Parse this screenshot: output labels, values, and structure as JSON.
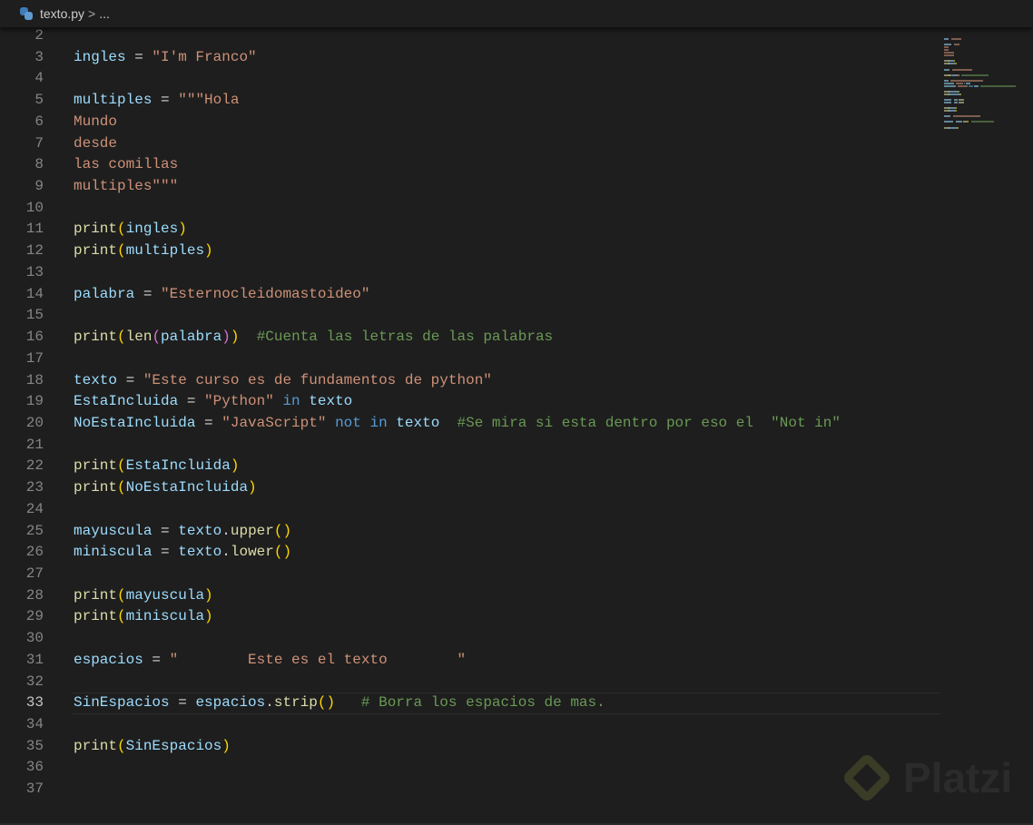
{
  "header": {
    "file_name": "texto.py",
    "separator": ">",
    "ellipsis": "..."
  },
  "watermark": "Platzi",
  "colors": {
    "background": "#1e1e1e",
    "variable": "#9cdcfe",
    "string": "#ce9178",
    "function": "#dcdcaa",
    "keyword": "#569cd6",
    "comment": "#6a9955"
  },
  "active_line": 33,
  "lines": [
    {
      "n": "2",
      "t": []
    },
    {
      "n": "3",
      "t": [
        [
          "var",
          "ingles"
        ],
        [
          "op",
          " = "
        ],
        [
          "str",
          "\"I'm Franco\""
        ]
      ]
    },
    {
      "n": "4",
      "t": []
    },
    {
      "n": "5",
      "t": [
        [
          "var",
          "multiples"
        ],
        [
          "op",
          " = "
        ],
        [
          "str",
          "\"\"\"Hola"
        ]
      ]
    },
    {
      "n": "6",
      "t": [
        [
          "str",
          "Mundo"
        ]
      ]
    },
    {
      "n": "7",
      "t": [
        [
          "str",
          "desde"
        ]
      ]
    },
    {
      "n": "8",
      "t": [
        [
          "str",
          "las comillas"
        ]
      ]
    },
    {
      "n": "9",
      "t": [
        [
          "str",
          "multiples\"\"\""
        ]
      ]
    },
    {
      "n": "10",
      "t": []
    },
    {
      "n": "11",
      "t": [
        [
          "fn",
          "print"
        ],
        [
          "p1",
          "("
        ],
        [
          "var",
          "ingles"
        ],
        [
          "p1",
          ")"
        ]
      ]
    },
    {
      "n": "12",
      "t": [
        [
          "fn",
          "print"
        ],
        [
          "p1",
          "("
        ],
        [
          "var",
          "multiples"
        ],
        [
          "p1",
          ")"
        ]
      ]
    },
    {
      "n": "13",
      "t": []
    },
    {
      "n": "14",
      "t": [
        [
          "var",
          "palabra"
        ],
        [
          "op",
          " = "
        ],
        [
          "str",
          "\"Esternocleidomastoideo\""
        ]
      ]
    },
    {
      "n": "15",
      "t": []
    },
    {
      "n": "16",
      "t": [
        [
          "fn",
          "print"
        ],
        [
          "p1",
          "("
        ],
        [
          "fn",
          "len"
        ],
        [
          "p2",
          "("
        ],
        [
          "var",
          "palabra"
        ],
        [
          "p2",
          ")"
        ],
        [
          "p1",
          ")"
        ],
        [
          "op",
          "  "
        ],
        [
          "com",
          "#Cuenta las letras de las palabras"
        ]
      ]
    },
    {
      "n": "17",
      "t": []
    },
    {
      "n": "18",
      "t": [
        [
          "var",
          "texto"
        ],
        [
          "op",
          " = "
        ],
        [
          "str",
          "\"Este curso es de fundamentos de python\""
        ]
      ]
    },
    {
      "n": "19",
      "t": [
        [
          "var",
          "EstaIncluida"
        ],
        [
          "op",
          " = "
        ],
        [
          "str",
          "\"Python\""
        ],
        [
          "op",
          " "
        ],
        [
          "kw",
          "in"
        ],
        [
          "op",
          " "
        ],
        [
          "var",
          "texto"
        ]
      ]
    },
    {
      "n": "20",
      "t": [
        [
          "var",
          "NoEstaIncluida"
        ],
        [
          "op",
          " = "
        ],
        [
          "str",
          "\"JavaScript\""
        ],
        [
          "op",
          " "
        ],
        [
          "kw",
          "not in"
        ],
        [
          "op",
          " "
        ],
        [
          "var",
          "texto"
        ],
        [
          "op",
          "  "
        ],
        [
          "com",
          "#Se mira si esta dentro por eso el  \"Not in\""
        ]
      ]
    },
    {
      "n": "21",
      "t": []
    },
    {
      "n": "22",
      "t": [
        [
          "fn",
          "print"
        ],
        [
          "p1",
          "("
        ],
        [
          "var",
          "EstaIncluida"
        ],
        [
          "p1",
          ")"
        ]
      ]
    },
    {
      "n": "23",
      "t": [
        [
          "fn",
          "print"
        ],
        [
          "p1",
          "("
        ],
        [
          "var",
          "NoEstaIncluida"
        ],
        [
          "p1",
          ")"
        ]
      ]
    },
    {
      "n": "24",
      "t": []
    },
    {
      "n": "25",
      "t": [
        [
          "var",
          "mayuscula"
        ],
        [
          "op",
          " = "
        ],
        [
          "var",
          "texto"
        ],
        [
          "op",
          "."
        ],
        [
          "fn",
          "upper"
        ],
        [
          "p1",
          "()"
        ]
      ]
    },
    {
      "n": "26",
      "t": [
        [
          "var",
          "miniscula"
        ],
        [
          "op",
          " = "
        ],
        [
          "var",
          "texto"
        ],
        [
          "op",
          "."
        ],
        [
          "fn",
          "lower"
        ],
        [
          "p1",
          "()"
        ]
      ]
    },
    {
      "n": "27",
      "t": []
    },
    {
      "n": "28",
      "t": [
        [
          "fn",
          "print"
        ],
        [
          "p1",
          "("
        ],
        [
          "var",
          "mayuscula"
        ],
        [
          "p1",
          ")"
        ]
      ]
    },
    {
      "n": "29",
      "t": [
        [
          "fn",
          "print"
        ],
        [
          "p1",
          "("
        ],
        [
          "var",
          "miniscula"
        ],
        [
          "p1",
          ")"
        ]
      ]
    },
    {
      "n": "30",
      "t": []
    },
    {
      "n": "31",
      "t": [
        [
          "var",
          "espacios"
        ],
        [
          "op",
          " = "
        ],
        [
          "str",
          "\"        Este es el texto        \""
        ]
      ]
    },
    {
      "n": "32",
      "t": []
    },
    {
      "n": "33",
      "t": [
        [
          "var",
          "SinEspacios"
        ],
        [
          "op",
          " = "
        ],
        [
          "var",
          "espacios"
        ],
        [
          "op",
          "."
        ],
        [
          "fn",
          "strip"
        ],
        [
          "p1",
          "()"
        ],
        [
          "op",
          "   "
        ],
        [
          "com",
          "# Borra los espacios de mas."
        ]
      ]
    },
    {
      "n": "34",
      "t": []
    },
    {
      "n": "35",
      "t": [
        [
          "fn",
          "print"
        ],
        [
          "p1",
          "("
        ],
        [
          "var",
          "SinEspacios"
        ],
        [
          "p1",
          ")"
        ]
      ]
    },
    {
      "n": "36",
      "t": []
    },
    {
      "n": "37",
      "t": []
    }
  ]
}
